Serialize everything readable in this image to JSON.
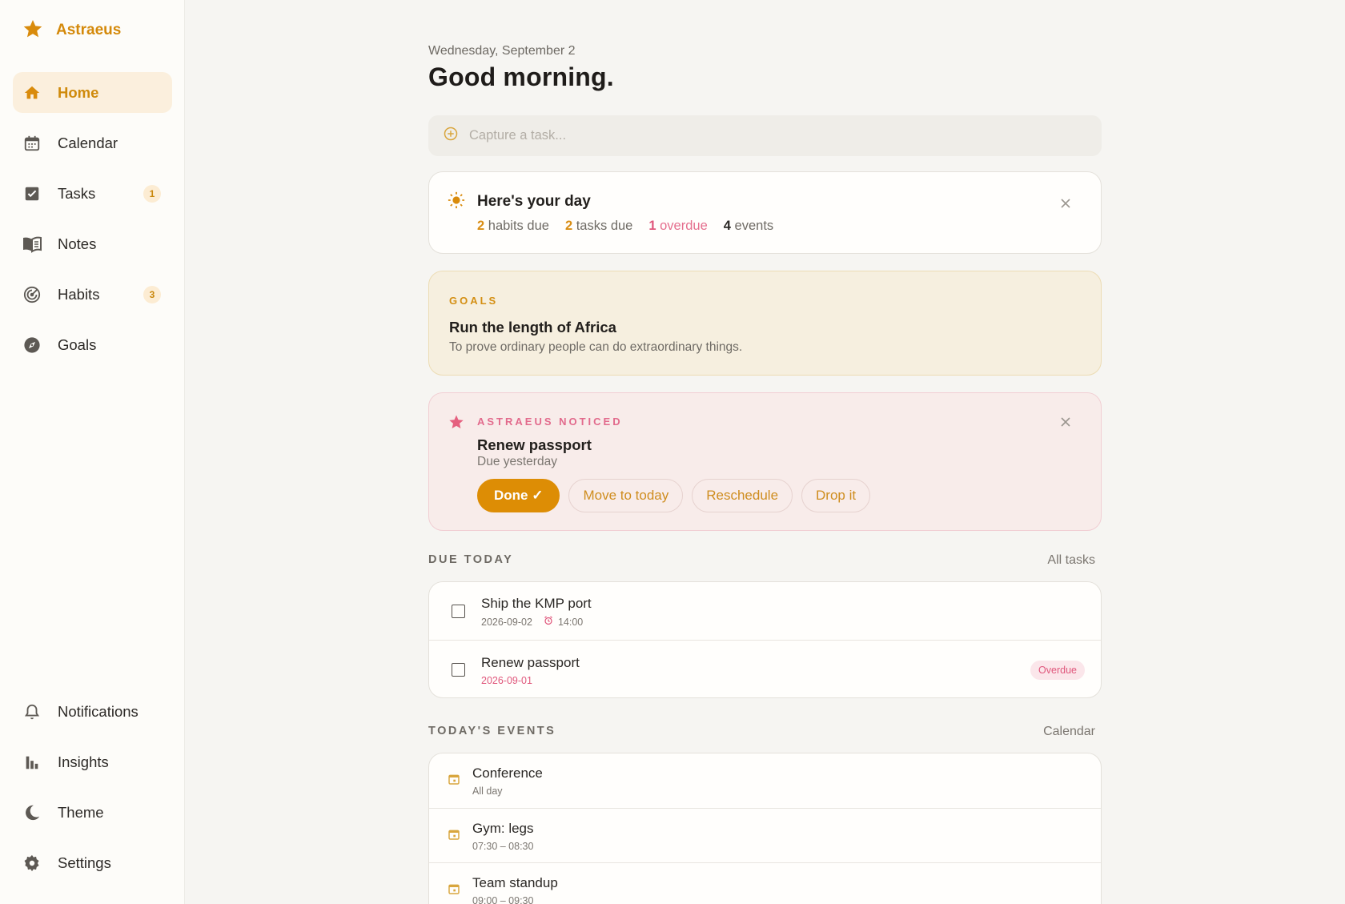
{
  "brand": {
    "name": "Astraeus",
    "icon": "star-icon",
    "color": "#d4890a"
  },
  "nav": {
    "items": [
      {
        "label": "Home",
        "icon": "home-icon",
        "active": true
      },
      {
        "label": "Calendar",
        "icon": "calendar-icon"
      },
      {
        "label": "Tasks",
        "icon": "checkbox-icon",
        "badge": "1"
      },
      {
        "label": "Notes",
        "icon": "book-icon"
      },
      {
        "label": "Habits",
        "icon": "target-icon",
        "badge": "3"
      },
      {
        "label": "Goals",
        "icon": "compass-icon"
      }
    ],
    "bottom": [
      {
        "label": "Notifications",
        "icon": "bell-icon"
      },
      {
        "label": "Insights",
        "icon": "bar-chart-icon"
      },
      {
        "label": "Theme",
        "icon": "moon-icon"
      },
      {
        "label": "Settings",
        "icon": "gear-icon"
      }
    ]
  },
  "header": {
    "date": "Wednesday, September 2",
    "greeting": "Good morning."
  },
  "capture": {
    "placeholder": "Capture a task..."
  },
  "day": {
    "title": "Here's your day",
    "stats": {
      "habits_num": "2",
      "habits_label": "habits due",
      "tasks_num": "2",
      "tasks_label": "tasks due",
      "overdue_num": "1",
      "overdue_label": "overdue",
      "events_num": "4",
      "events_label": "events"
    }
  },
  "goals": {
    "label": "GOALS",
    "title": "Run the length of Africa",
    "subtitle": "To prove ordinary people can do extraordinary things."
  },
  "notice": {
    "label": "ASTRAEUS NOTICED",
    "title": "Renew passport",
    "subtitle": "Due yesterday",
    "actions": {
      "done": "Done ✓",
      "move": "Move to today",
      "reschedule": "Reschedule",
      "drop": "Drop it"
    }
  },
  "due_today": {
    "title": "DUE TODAY",
    "link": "All tasks",
    "tasks": [
      {
        "title": "Ship the KMP port",
        "date": "2026-09-02",
        "time": "14:00"
      },
      {
        "title": "Renew passport",
        "date": "2026-09-01",
        "badge": "Overdue"
      }
    ]
  },
  "events": {
    "title": "TODAY'S EVENTS",
    "link": "Calendar",
    "items": [
      {
        "title": "Conference",
        "time": "All day"
      },
      {
        "title": "Gym: legs",
        "time": "07:30 – 08:30"
      },
      {
        "title": "Team standup",
        "time": "09:00 – 09:30"
      }
    ]
  },
  "colors": {
    "accent": "#dd8d05",
    "pink": "#e0577c",
    "background": "#f6f5f2"
  }
}
